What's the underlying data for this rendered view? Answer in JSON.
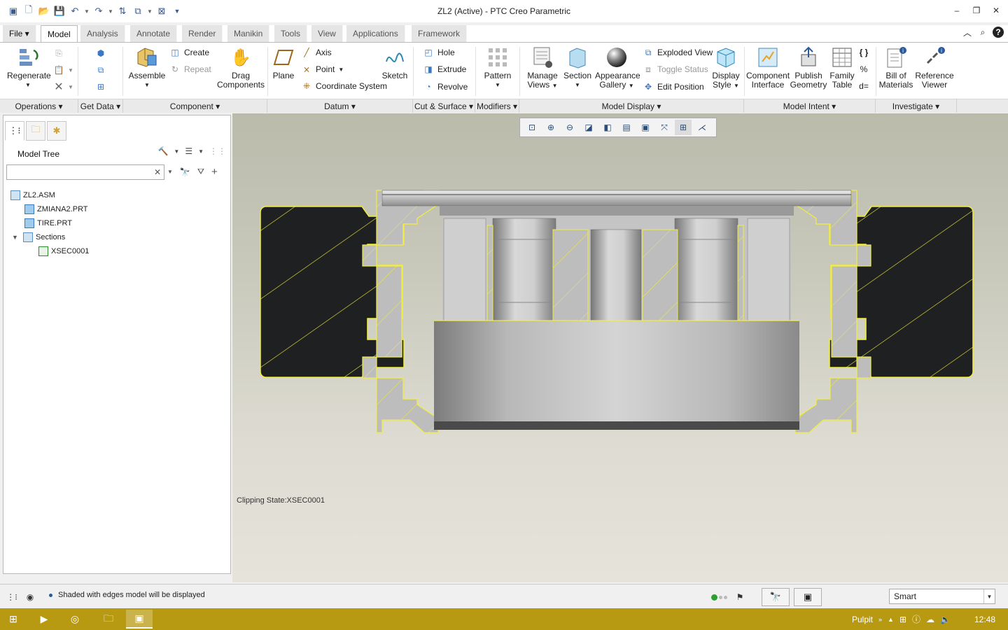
{
  "window": {
    "title": "ZL2 (Active) - PTC Creo Parametric"
  },
  "quick_access": {
    "icons": [
      "app-icon",
      "new-icon",
      "open-icon",
      "save-icon",
      "undo-icon",
      "redo-icon",
      "regenerate-icon",
      "windows-icon",
      "close-window-icon",
      "customize-icon"
    ]
  },
  "ribbon_tabs": [
    "File",
    "Model",
    "Analysis",
    "Annotate",
    "Render",
    "Manikin",
    "Tools",
    "View",
    "Applications",
    "Framework"
  ],
  "active_tab": "Model",
  "ribbon": {
    "regenerate": "Regenerate",
    "create": "Create",
    "repeat": "Repeat",
    "assemble": "Assemble",
    "drag_components": [
      "Drag",
      "Components"
    ],
    "plane": "Plane",
    "axis": "Axis",
    "point": "Point",
    "coordinate_system": "Coordinate System",
    "sketch": "Sketch",
    "hole": "Hole",
    "extrude": "Extrude",
    "revolve": "Revolve",
    "pattern": "Pattern",
    "manage_views": [
      "Manage",
      "Views"
    ],
    "section": "Section",
    "appearance_gallery": [
      "Appearance",
      "Gallery"
    ],
    "exploded_view": "Exploded View",
    "toggle_status": "Toggle Status",
    "edit_position": "Edit Position",
    "display_style": [
      "Display",
      "Style"
    ],
    "component_interface": [
      "Component",
      "Interface"
    ],
    "publish_geometry": [
      "Publish",
      "Geometry"
    ],
    "family_table": [
      "Family",
      "Table"
    ],
    "bill_of_materials": [
      "Bill of",
      "Materials"
    ],
    "reference_viewer": [
      "Reference",
      "Viewer"
    ]
  },
  "group_labels": {
    "operations": "Operations",
    "get_data": "Get Data",
    "component": "Component",
    "datum": "Datum",
    "cut_surface": "Cut & Surface",
    "modifiers": "Modifiers",
    "model_display": "Model Display",
    "model_intent": "Model Intent",
    "investigate": "Investigate"
  },
  "model_tree": {
    "title": "Model Tree",
    "search_placeholder": "",
    "items": [
      {
        "label": "ZL2.ASM",
        "level": 0
      },
      {
        "label": "ZMIANA2.PRT",
        "level": 1
      },
      {
        "label": "TIRE.PRT",
        "level": 1
      },
      {
        "label": "Sections",
        "level": 1
      },
      {
        "label": "XSEC0001",
        "level": 2
      }
    ]
  },
  "graphics": {
    "clipping_state": "Clipping State:XSEC0001",
    "section_fill": "#1f2021",
    "section_edge": "#f2ee3c",
    "metal_color": "#bdbdbd"
  },
  "status": {
    "message": "Shaded with edges model will be displayed",
    "selection_filter": "Smart"
  },
  "taskbar": {
    "location": "Pulpit",
    "time": "12:48"
  },
  "colors": {
    "taskbar": "#b89a12",
    "accent": "#2a5a9a"
  }
}
